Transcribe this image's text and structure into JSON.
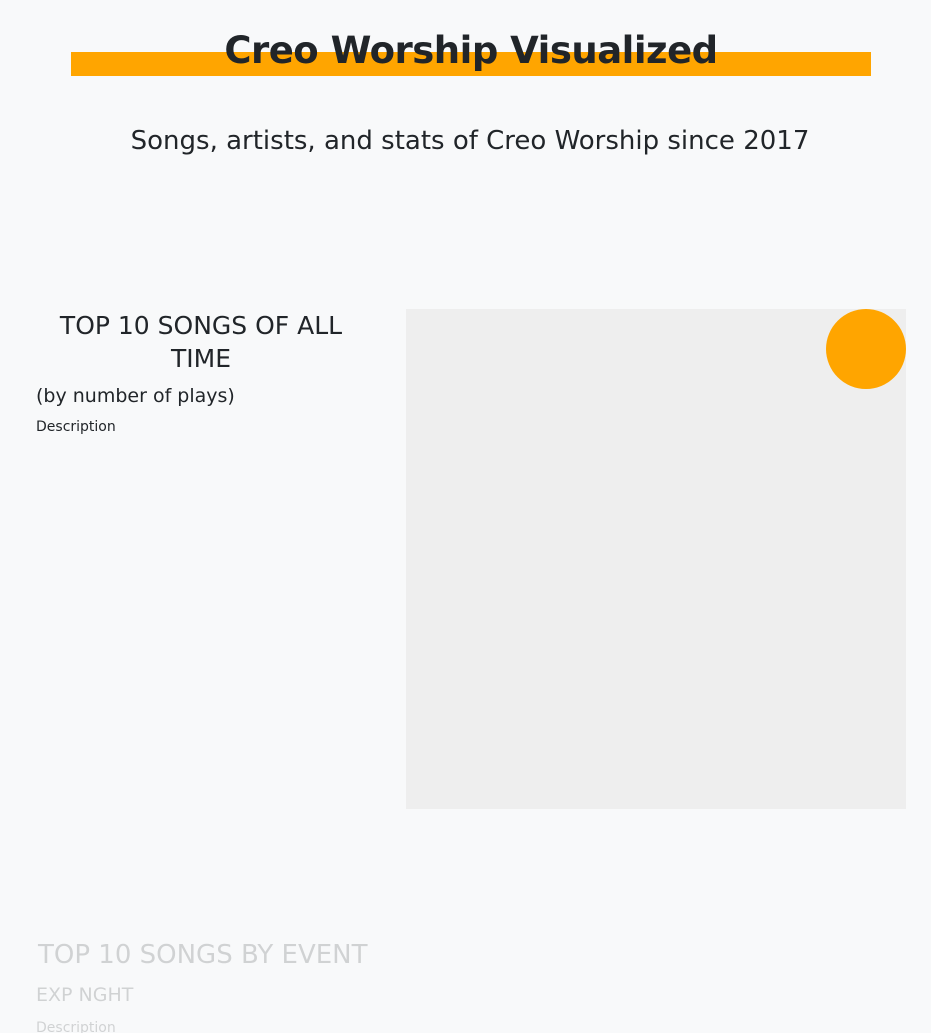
{
  "header": {
    "title": "Creo Worship Visualized",
    "subtitle": "Songs, artists, and stats of Creo Worship since 2017",
    "accent_color": "#ffa500"
  },
  "sections": [
    {
      "heading": "TOP 10 SONGS OF ALL TIME",
      "subheading": "(by number of plays)",
      "description": "Description"
    },
    {
      "heading": "TOP 10 SONGS BY EVENT",
      "subheading": "EXP NGHT",
      "description": "Description"
    }
  ],
  "chart": {
    "background_color": "#eeeeee",
    "marker_color": "#ffa500"
  }
}
